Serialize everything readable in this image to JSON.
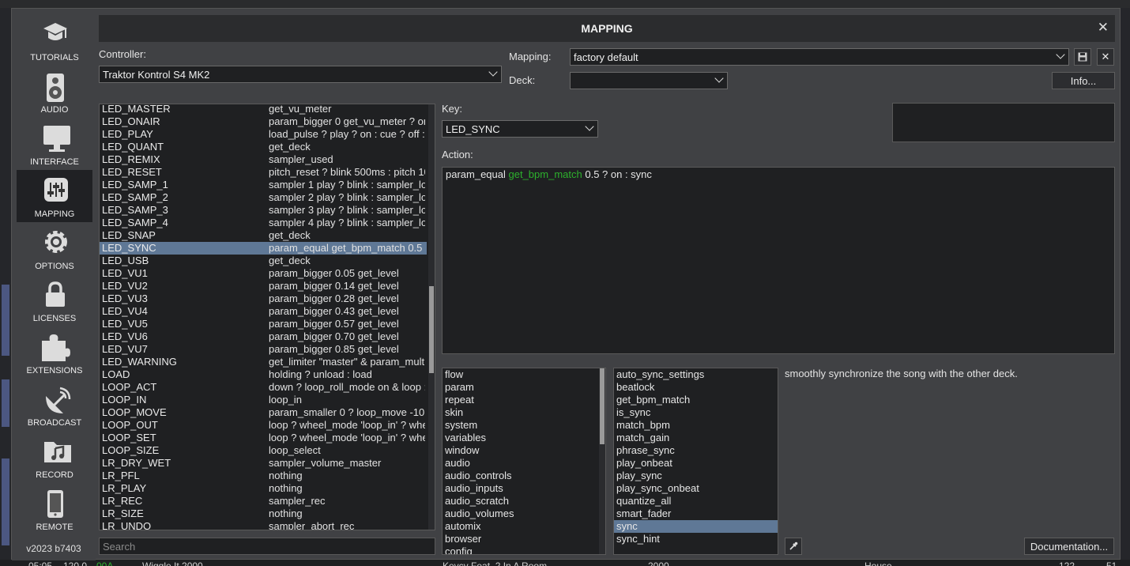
{
  "background": {
    "bottom_bar": [
      "05:05",
      "120.0",
      "00A",
      "Wiggle It 2000",
      "Keycy Feat. 2 In A Room",
      "2000",
      "House",
      "122",
      "51"
    ]
  },
  "sidebar": {
    "items": [
      {
        "label": "TUTORIALS",
        "icon": "graduation-cap-icon"
      },
      {
        "label": "AUDIO",
        "icon": "speaker-icon"
      },
      {
        "label": "INTERFACE",
        "icon": "monitor-icon"
      },
      {
        "label": "MAPPING",
        "icon": "sliders-icon",
        "active": true
      },
      {
        "label": "OPTIONS",
        "icon": "gear-icon"
      },
      {
        "label": "LICENSES",
        "icon": "lock-icon"
      },
      {
        "label": "EXTENSIONS",
        "icon": "puzzle-icon"
      },
      {
        "label": "BROADCAST",
        "icon": "satellite-dish-icon"
      },
      {
        "label": "RECORD",
        "icon": "music-folder-icon"
      },
      {
        "label": "REMOTE",
        "icon": "phone-icon"
      }
    ],
    "version": "v2023 b7403"
  },
  "window": {
    "title": "MAPPING",
    "close": "✕"
  },
  "controller": {
    "label": "Controller:",
    "value": "Traktor Kontrol S4 MK2"
  },
  "mapping": {
    "label": "Mapping:",
    "value": "factory default",
    "save_icon": "save-icon",
    "delete": "✕"
  },
  "deck": {
    "label": "Deck:",
    "value": ""
  },
  "info_button": "Info...",
  "key": {
    "label": "Key:",
    "value": "LED_SYNC"
  },
  "action": {
    "label": "Action:",
    "prefix": "param_equal ",
    "fn": "get_bpm_match",
    "suffix": " 0.5 ? on : sync"
  },
  "key_list": [
    {
      "key": "LED_MASTER",
      "action": "get_vu_meter"
    },
    {
      "key": "LED_ONAIR",
      "action": "param_bigger 0 get_vu_meter ? on"
    },
    {
      "key": "LED_PLAY",
      "action": "load_pulse ? play ? on : cue ? off :"
    },
    {
      "key": "LED_QUANT",
      "action": "get_deck"
    },
    {
      "key": "LED_REMIX",
      "action": "sampler_used"
    },
    {
      "key": "LED_RESET",
      "action": "pitch_reset ? blink 500ms : pitch 10"
    },
    {
      "key": "LED_SAMP_1",
      "action": "sampler 1 play ? blink : sampler_lo"
    },
    {
      "key": "LED_SAMP_2",
      "action": "sampler 2 play ? blink : sampler_lo"
    },
    {
      "key": "LED_SAMP_3",
      "action": "sampler 3 play ? blink : sampler_lo"
    },
    {
      "key": "LED_SAMP_4",
      "action": "sampler 4 play ? blink : sampler_lo"
    },
    {
      "key": "LED_SNAP",
      "action": "get_deck"
    },
    {
      "key": "LED_SYNC",
      "action": "param_equal get_bpm_match 0.5",
      "selected": true
    },
    {
      "key": "LED_USB",
      "action": "get_deck"
    },
    {
      "key": "LED_VU1",
      "action": "param_bigger 0.05 get_level"
    },
    {
      "key": "LED_VU2",
      "action": "param_bigger 0.14 get_level"
    },
    {
      "key": "LED_VU3",
      "action": "param_bigger 0.28 get_level"
    },
    {
      "key": "LED_VU4",
      "action": "param_bigger 0.43 get_level"
    },
    {
      "key": "LED_VU5",
      "action": "param_bigger 0.57 get_level"
    },
    {
      "key": "LED_VU6",
      "action": "param_bigger 0.70 get_level"
    },
    {
      "key": "LED_VU7",
      "action": "param_bigger 0.85 get_level"
    },
    {
      "key": "LED_WARNING",
      "action": "get_limiter \"master\" & param_mult"
    },
    {
      "key": "LOAD",
      "action": "holding ? unload : load"
    },
    {
      "key": "LOOP_ACT",
      "action": "down ? loop_roll_mode on & loop :"
    },
    {
      "key": "LOOP_IN",
      "action": "loop_in"
    },
    {
      "key": "LOOP_MOVE",
      "action": "param_smaller 0 ? loop_move -10"
    },
    {
      "key": "LOOP_OUT",
      "action": "loop ? wheel_mode 'loop_in' ? whe"
    },
    {
      "key": "LOOP_SET",
      "action": "loop ? wheel_mode 'loop_in' ? whe"
    },
    {
      "key": "LOOP_SIZE",
      "action": "loop_select"
    },
    {
      "key": "LR_DRY_WET",
      "action": "sampler_volume_master"
    },
    {
      "key": "LR_PFL",
      "action": "nothing"
    },
    {
      "key": "LR_PLAY",
      "action": "nothing"
    },
    {
      "key": "LR_REC",
      "action": "sampler_rec"
    },
    {
      "key": "LR_SIZE",
      "action": "nothing"
    },
    {
      "key": "LR_UNDO",
      "action": "sampler_abort_rec"
    }
  ],
  "search": {
    "placeholder": "Search"
  },
  "categories": [
    "flow",
    "param",
    "repeat",
    "skin",
    "system",
    "variables",
    "window",
    "audio",
    "audio_controls",
    "audio_inputs",
    "audio_scratch",
    "audio_volumes",
    "automix",
    "browser",
    "config"
  ],
  "verbs": [
    "auto_sync_settings",
    "beatlock",
    "get_bpm_match",
    "is_sync",
    "match_bpm",
    "match_gain",
    "phrase_sync",
    "play_onbeat",
    "play_sync",
    "play_sync_onbeat",
    "quantize_all",
    "smart_fader",
    "sync",
    "sync_hint"
  ],
  "selected_verb": "sync",
  "description": "smoothly synchronize the song with the other deck.",
  "picker_icon": "eyedropper-icon",
  "documentation_button": "Documentation..."
}
